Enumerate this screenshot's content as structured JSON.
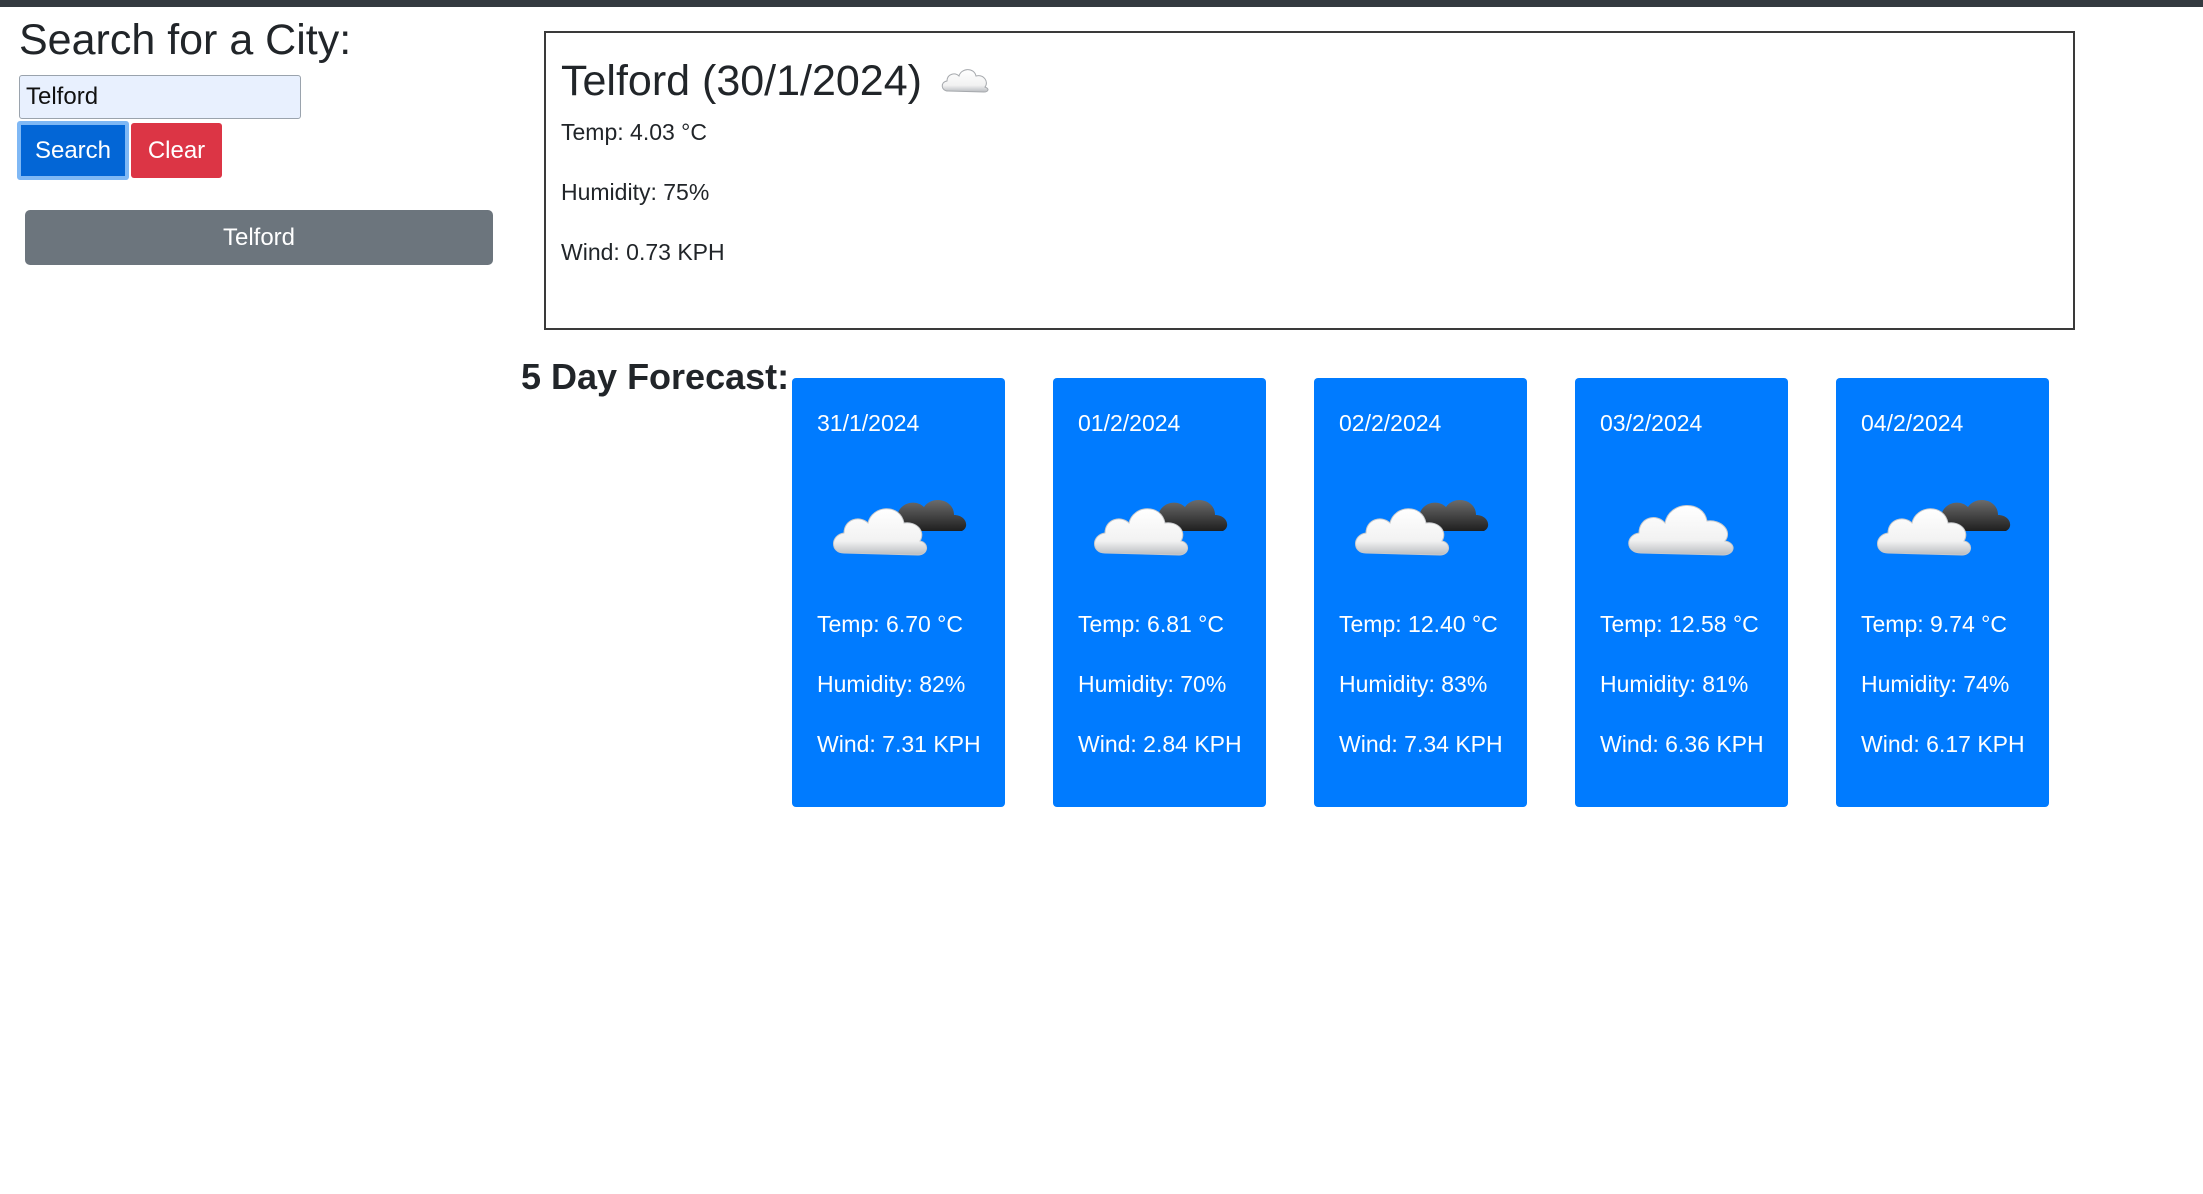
{
  "search": {
    "title": "Search for a City:",
    "input_value": "Telford",
    "search_label": "Search",
    "clear_label": "Clear"
  },
  "history": [
    "Telford"
  ],
  "current": {
    "title": "Telford (30/1/2024)",
    "icon": "cloud-icon",
    "temp": "Temp: 4.03 °C",
    "humidity": "Humidity: 75%",
    "wind": "Wind: 0.73 KPH"
  },
  "forecast": {
    "title": "5 Day Forecast:",
    "days": [
      {
        "date": "31/1/2024",
        "icon": "partly-cloudy-icon",
        "temp": "Temp: 6.70 °C",
        "humidity": "Humidity: 82%",
        "wind": "Wind: 7.31 KPH"
      },
      {
        "date": "01/2/2024",
        "icon": "partly-cloudy-icon",
        "temp": "Temp: 6.81 °C",
        "humidity": "Humidity: 70%",
        "wind": "Wind: 2.84 KPH"
      },
      {
        "date": "02/2/2024",
        "icon": "partly-cloudy-icon",
        "temp": "Temp: 12.40 °C",
        "humidity": "Humidity: 83%",
        "wind": "Wind: 7.34 KPH"
      },
      {
        "date": "03/2/2024",
        "icon": "cloud-icon",
        "temp": "Temp: 12.58 °C",
        "humidity": "Humidity: 81%",
        "wind": "Wind: 6.36 KPH"
      },
      {
        "date": "04/2/2024",
        "icon": "partly-cloudy-icon",
        "temp": "Temp: 9.74 °C",
        "humidity": "Humidity: 74%",
        "wind": "Wind: 6.17 KPH"
      }
    ]
  },
  "colors": {
    "topbar": "#343a40",
    "primary": "#007bff",
    "danger": "#dc3545",
    "secondary": "#6c757d"
  }
}
